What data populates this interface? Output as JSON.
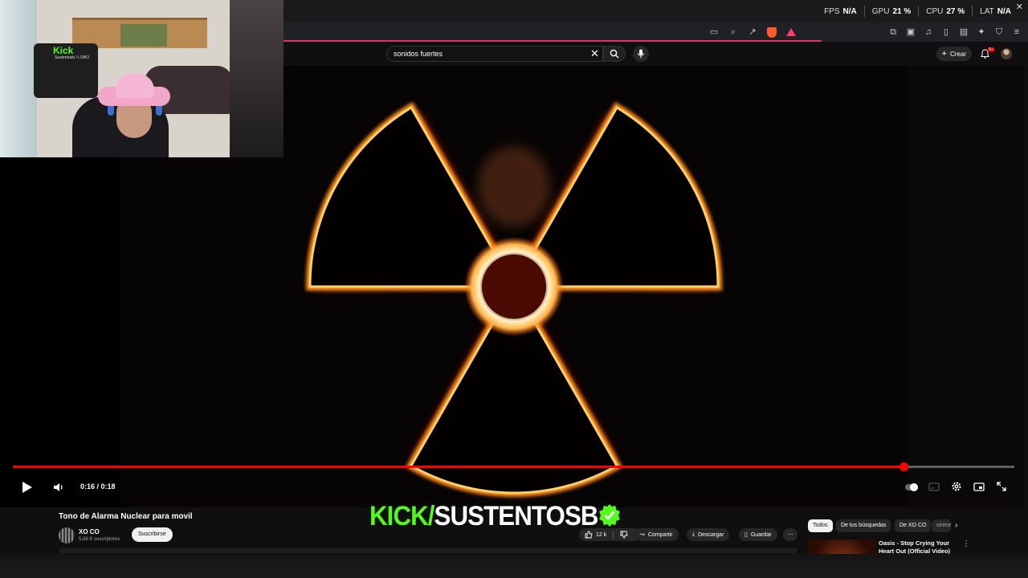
{
  "overlay": {
    "fps_label": "FPS",
    "fps_value": "N/A",
    "gpu_label": "GPU",
    "gpu_value": "21 %",
    "cpu_label": "CPU",
    "cpu_value": "27 %",
    "lat_label": "LAT",
    "lat_value": "N/A"
  },
  "search": {
    "value": "sonidos fuertes"
  },
  "header": {
    "create_label": "Crear",
    "notification_badge": "9+"
  },
  "player": {
    "time": "0:16 / 0:18",
    "progress_fraction": 0.889
  },
  "video": {
    "title": "Tono de Alarma Nuclear para movil",
    "channel": "XO CO",
    "subscribers": "5,88 K suscriptores",
    "subscribe_label": "Suscribirse",
    "likes": "12 k",
    "share_label": "Compartir",
    "download_label": "Descargar",
    "save_label": "Guardar"
  },
  "overlay_banner": {
    "kick": "KICK",
    "slash": "/",
    "name": "SUSTENTOSB"
  },
  "webcam": {
    "shirt_text": "Kick",
    "shirt_sub": "Sustentosb / LOBO"
  },
  "chips": [
    "Todos",
    "De tus búsquedas",
    "De XO CO",
    "sirenas"
  ],
  "recommendation": {
    "title": "Oasis - Stop Crying Your Heart Out (Official Video)"
  },
  "colors": {
    "accent": "#ff0000",
    "kick_green": "#53fc18"
  }
}
